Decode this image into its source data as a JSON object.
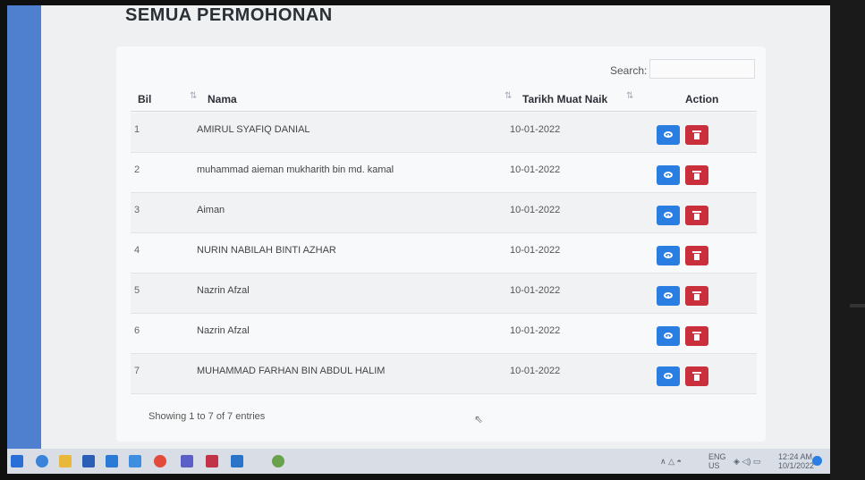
{
  "page": {
    "title": "SEMUA PERMOHONAN"
  },
  "search": {
    "label": "Search:",
    "value": ""
  },
  "table": {
    "columns": [
      "Bil",
      "Nama",
      "Tarikh Muat Naik",
      "Action"
    ],
    "rows": [
      {
        "bil": "1",
        "nama": "AMIRUL SYAFIQ DANIAL",
        "tarikh": "10-01-2022"
      },
      {
        "bil": "2",
        "nama": "muhammad aieman mukharith bin md. kamal",
        "tarikh": "10-01-2022"
      },
      {
        "bil": "3",
        "nama": "Aiman",
        "tarikh": "10-01-2022"
      },
      {
        "bil": "4",
        "nama": "NURIN NABILAH BINTI AZHAR",
        "tarikh": "10-01-2022"
      },
      {
        "bil": "5",
        "nama": "Nazrin Afzal",
        "tarikh": "10-01-2022"
      },
      {
        "bil": "6",
        "nama": "Nazrin Afzal",
        "tarikh": "10-01-2022"
      },
      {
        "bil": "7",
        "nama": "MUHAMMAD FARHAN BIN ABDUL HALIM",
        "tarikh": "10-01-2022"
      }
    ]
  },
  "footer": {
    "info": "Showing 1 to 7 of 7 entries"
  },
  "taskbar": {
    "lang": "ENG",
    "region": "US",
    "time": "12:24 AM",
    "date": "10/1/2022",
    "icons": [
      "windows-icon",
      "search-icon",
      "file-explorer-icon",
      "mail-icon",
      "store-icon",
      "chrome-icon",
      "teams-icon",
      "word-icon",
      "outlook-icon",
      "photos-icon",
      "media-player-icon"
    ]
  },
  "colors": {
    "view": "#2a7de1",
    "delete": "#c9303c",
    "sidebar": "#4f7fcf"
  }
}
